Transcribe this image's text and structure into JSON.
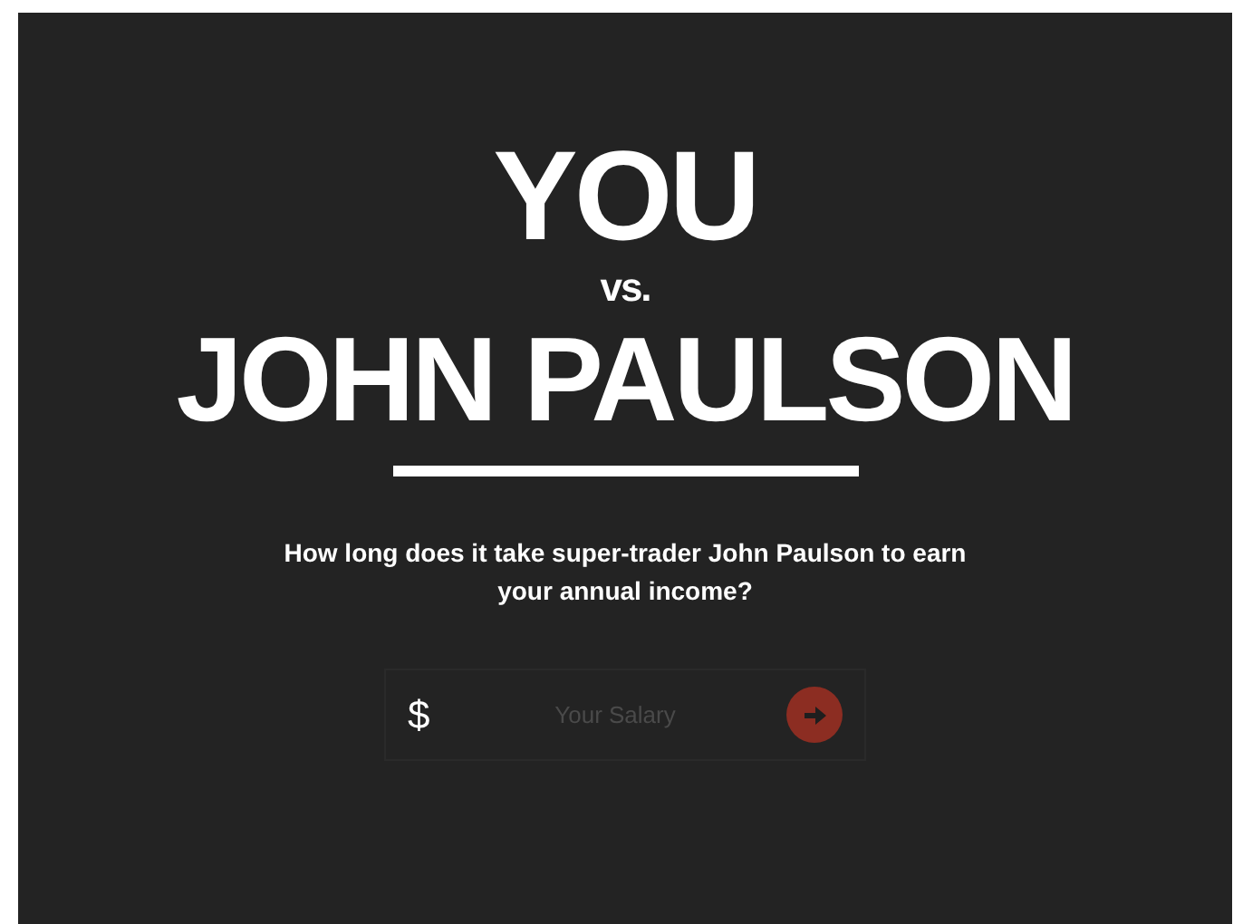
{
  "headline": {
    "top": "YOU",
    "middle": "vs.",
    "bottom": "JOHN PAULSON"
  },
  "question": "How long does it take super-trader John Paulson to earn your annual income?",
  "salary_form": {
    "currency": "$",
    "placeholder": "Your Salary"
  }
}
